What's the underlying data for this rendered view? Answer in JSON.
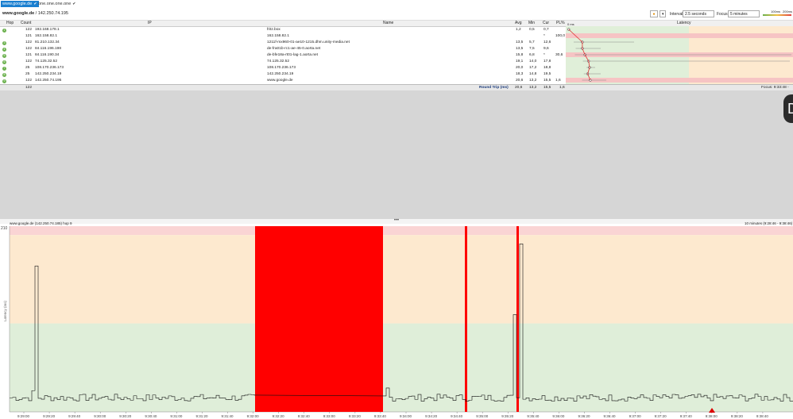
{
  "tabs": [
    {
      "label": "www.google.de",
      "active": true
    },
    {
      "label": "one.one.one.one",
      "active": false
    }
  ],
  "infobar": {
    "host": "www.google.de",
    "ip": "142.250.74.195",
    "interval_label": "Interval",
    "interval_value": "2.5 seconds",
    "focus_label": "Focus",
    "focus_value": "5 minutes",
    "scale_low": "100ms",
    "scale_high": "200ms"
  },
  "table": {
    "headers": [
      "Hop",
      "Count",
      "IP",
      "Name",
      "Avg",
      "Min",
      "Cur",
      "PL%",
      "Latency"
    ],
    "latency_axis_label": "0 ms",
    "rows": [
      {
        "hop": "1",
        "count": "122",
        "ip": "192.168.178.1",
        "name": "fritz.box",
        "avg": "1,2",
        "min": "0,5",
        "cur": "0,7",
        "pl": "",
        "icon": true
      },
      {
        "hop": "",
        "count": "121",
        "ip": "162.158.82.1",
        "name": "162.158.82.1",
        "avg": "",
        "min": "",
        "cur": "*",
        "pl": "100,0",
        "icon": false
      },
      {
        "hop": "3",
        "count": "122",
        "ip": "81.210.132.34",
        "name": "1211f-mx960-01-ae10-1215.dhm.unity-media.net",
        "avg": "13,5",
        "min": "5,7",
        "cur": "12,6",
        "pl": "",
        "icon": true
      },
      {
        "hop": "4",
        "count": "122",
        "ip": "84.116.196.198",
        "name": "de-fra01b-rc1-ae-45-0.aorta.net",
        "avg": "13,5",
        "min": "7,5",
        "cur": "9,6",
        "pl": "",
        "icon": true
      },
      {
        "hop": "5",
        "count": "121",
        "ip": "84.116.190.34",
        "name": "de-bfe18a-rt01-lag-1.aorta.net",
        "avg": "15,8",
        "min": "6,8",
        "cur": "*",
        "pl": "30,6",
        "icon": true
      },
      {
        "hop": "6",
        "count": "122",
        "ip": "74.125.32.52",
        "name": "74.125.32.52",
        "avg": "19,1",
        "min": "14,0",
        "cur": "17,8",
        "pl": "",
        "icon": true
      },
      {
        "hop": "7",
        "count": "25",
        "ip": "108.170.236.173",
        "name": "108.170.236.173",
        "avg": "20,0",
        "min": "17,2",
        "cur": "18,8",
        "pl": "",
        "icon": true
      },
      {
        "hop": "8",
        "count": "25",
        "ip": "142.250.234.19",
        "name": "142.250.234.19",
        "avg": "18,3",
        "min": "14,8",
        "cur": "19,5",
        "pl": "",
        "icon": true
      },
      {
        "hop": "9",
        "count": "122",
        "ip": "142.250.74.195",
        "name": "www.google.de",
        "avg": "20,6",
        "min": "13,2",
        "cur": "15,5",
        "pl": "1,6",
        "icon": true
      }
    ],
    "summary": {
      "count": "122",
      "label": "Round Trip (ms)",
      "avg": "20,6",
      "min": "13,2",
      "cur": "15,5",
      "pl": "1,6",
      "focus": "Focus: 9:33:48 - 9:3"
    }
  },
  "chart": {
    "title": "www.google.de (142.250.74.185) hop 9",
    "range": "10 minutes (9:28:46 - 9:38:46)",
    "ylabel": "Latency (ms)",
    "ymax_label": "210",
    "colors": {
      "red": "#ff0000",
      "green_zone": "#dfeed9",
      "orange_zone": "#fde9cf",
      "pink_zone": "#fad4d4"
    },
    "xticks": [
      "9:29:00",
      "9:29:20",
      "9:29:40",
      "9:30:00",
      "9:30:20",
      "9:30:40",
      "9:31:00",
      "9:31:20",
      "9:31:40",
      "9:32:00",
      "9:32:20",
      "9:32:40",
      "9:33:00",
      "9:33:20",
      "9:33:40",
      "9:34:00",
      "9:34:20",
      "9:34:40",
      "9:35:00",
      "9:35:20",
      "9:35:40",
      "9:36:00",
      "9:36:20",
      "9:36:40",
      "9:37:00",
      "9:37:20",
      "9:37:40",
      "9:38:00",
      "9:38:20",
      "9:38:40"
    ]
  },
  "icons": {
    "warning": "warning-icon",
    "check": "check-icon",
    "dropdown": "chevron-down-icon",
    "marker": "triangle-marker-icon"
  }
}
